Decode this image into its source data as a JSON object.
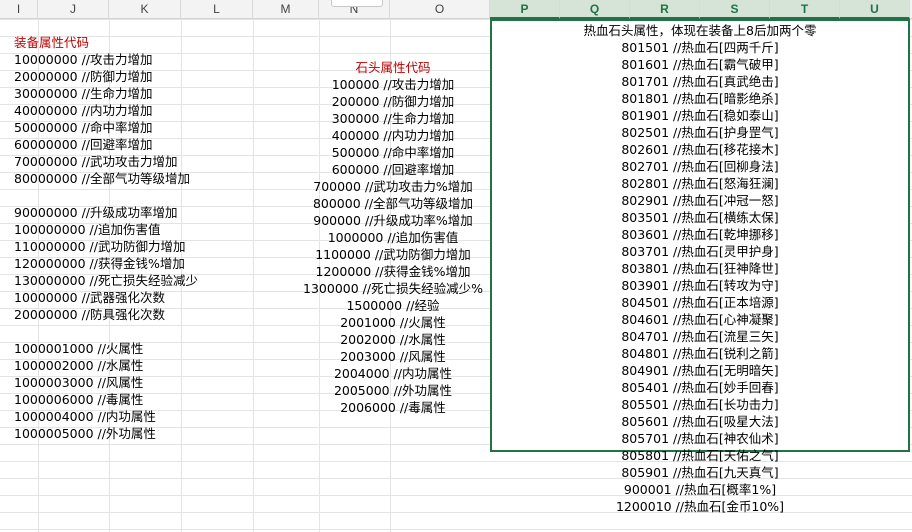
{
  "columns": [
    "I",
    "J",
    "K",
    "L",
    "M",
    "N",
    "O",
    "P",
    "Q",
    "R",
    "S",
    "T",
    "U"
  ],
  "selected_columns": [
    "P",
    "Q",
    "R",
    "S",
    "T",
    "U"
  ],
  "equipment": {
    "title": "装备属性代码",
    "group1": [
      "10000000 //攻击力增加",
      "20000000 //防御力增加",
      "30000000 //生命力增加",
      "40000000 //内功力增加",
      "50000000 //命中率增加",
      "60000000 //回避率增加",
      "70000000 //武功攻击力增加",
      "80000000 //全部气功等级增加"
    ],
    "group2": [
      "90000000 //升级成功率增加",
      "100000000 //追加伤害值",
      "110000000 //武功防御力增加",
      "120000000 //获得金钱%增加",
      "130000000 //死亡损失经验减少",
      "10000000 //武器强化次数",
      "20000000 //防具强化次数"
    ],
    "group3": [
      "1000001000 //火属性",
      "1000002000 //水属性",
      "1000003000 //风属性",
      "1000006000 //毒属性",
      "1000004000 //内功属性",
      "1000005000 //外功属性"
    ]
  },
  "stone": {
    "title": "石头属性代码",
    "items": [
      "100000 //攻击力增加",
      "200000 //防御力增加",
      "300000 //生命力增加",
      "400000 //内功力增加",
      "500000 //命中率增加",
      "600000 //回避率增加",
      "700000 //武功攻击力%增加",
      "800000 //全部气功等级增加",
      "900000 //升级成功率%增加",
      "1000000 //追加伤害值",
      "1100000 //武功防御力增加",
      "1200000 //获得金钱%增加",
      "1300000 //死亡损失经验减少%",
      "1500000 //经验",
      "2001000 //火属性",
      "2002000 //水属性",
      "2003000 //风属性",
      "2004000 //内功属性",
      "2005000 //外功属性",
      "2006000 //毒属性"
    ]
  },
  "hotblood": {
    "title": "热血石头属性，体现在装备上8后加两个零",
    "items": [
      "801501 //热血石[四两千斤]",
      "801601 //热血石[霸气破甲]",
      "801701 //热血石[真武绝击]",
      "801801 //热血石[暗影绝杀]",
      "801901 //热血石[稳如泰山]",
      "802501 //热血石[护身罡气]",
      "802601 //热血石[移花接木]",
      "802701 //热血石[回柳身法]",
      "802801 //热血石[怒海狂澜]",
      "802901 //热血石[冲冠一怒]",
      "803501 //热血石[横练太保]",
      "803601 //热血石[乾坤挪移]",
      "803701 //热血石[灵甲护身]",
      "803801 //热血石[狂神降世]",
      "803901 //热血石[转攻为守]",
      "804501 //热血石[正本培源]",
      "804601 //热血石[心神凝聚]",
      "804701 //热血石[流星三矢]",
      "804801 //热血石[锐利之箭]",
      "804901 //热血石[无明暗矢]",
      "805401 //热血石[妙手回春]",
      "805501 //热血石[长功击力]",
      "805601 //热血石[吸星大法]",
      "805701 //热血石[神农仙术]",
      "805801 //热血石[天佑之气]",
      "805901 //热血石[九天真气]",
      "900001 //热血石[概率1%]",
      "1200010 //热血石[金币10%]"
    ]
  }
}
